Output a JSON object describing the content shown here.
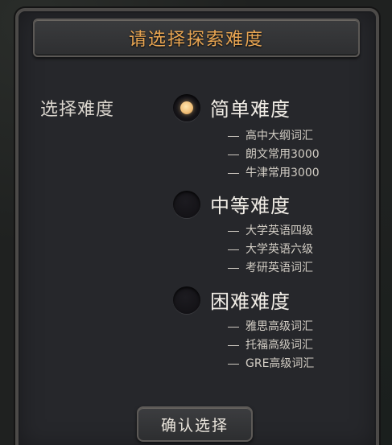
{
  "dialog": {
    "title": "请选择探索难度",
    "side_label": "选择难度",
    "confirm_label": "确认选择",
    "selected": 0,
    "accent_color": "#e8a552",
    "options": [
      {
        "label": "简单难度",
        "items": [
          "高中大纲词汇",
          "朗文常用3000",
          "牛津常用3000"
        ]
      },
      {
        "label": "中等难度",
        "items": [
          "大学英语四级",
          "大学英语六级",
          "考研英语词汇"
        ]
      },
      {
        "label": "困难难度",
        "items": [
          "雅思高级词汇",
          "托福高级词汇",
          "GRE高级词汇"
        ]
      }
    ]
  }
}
